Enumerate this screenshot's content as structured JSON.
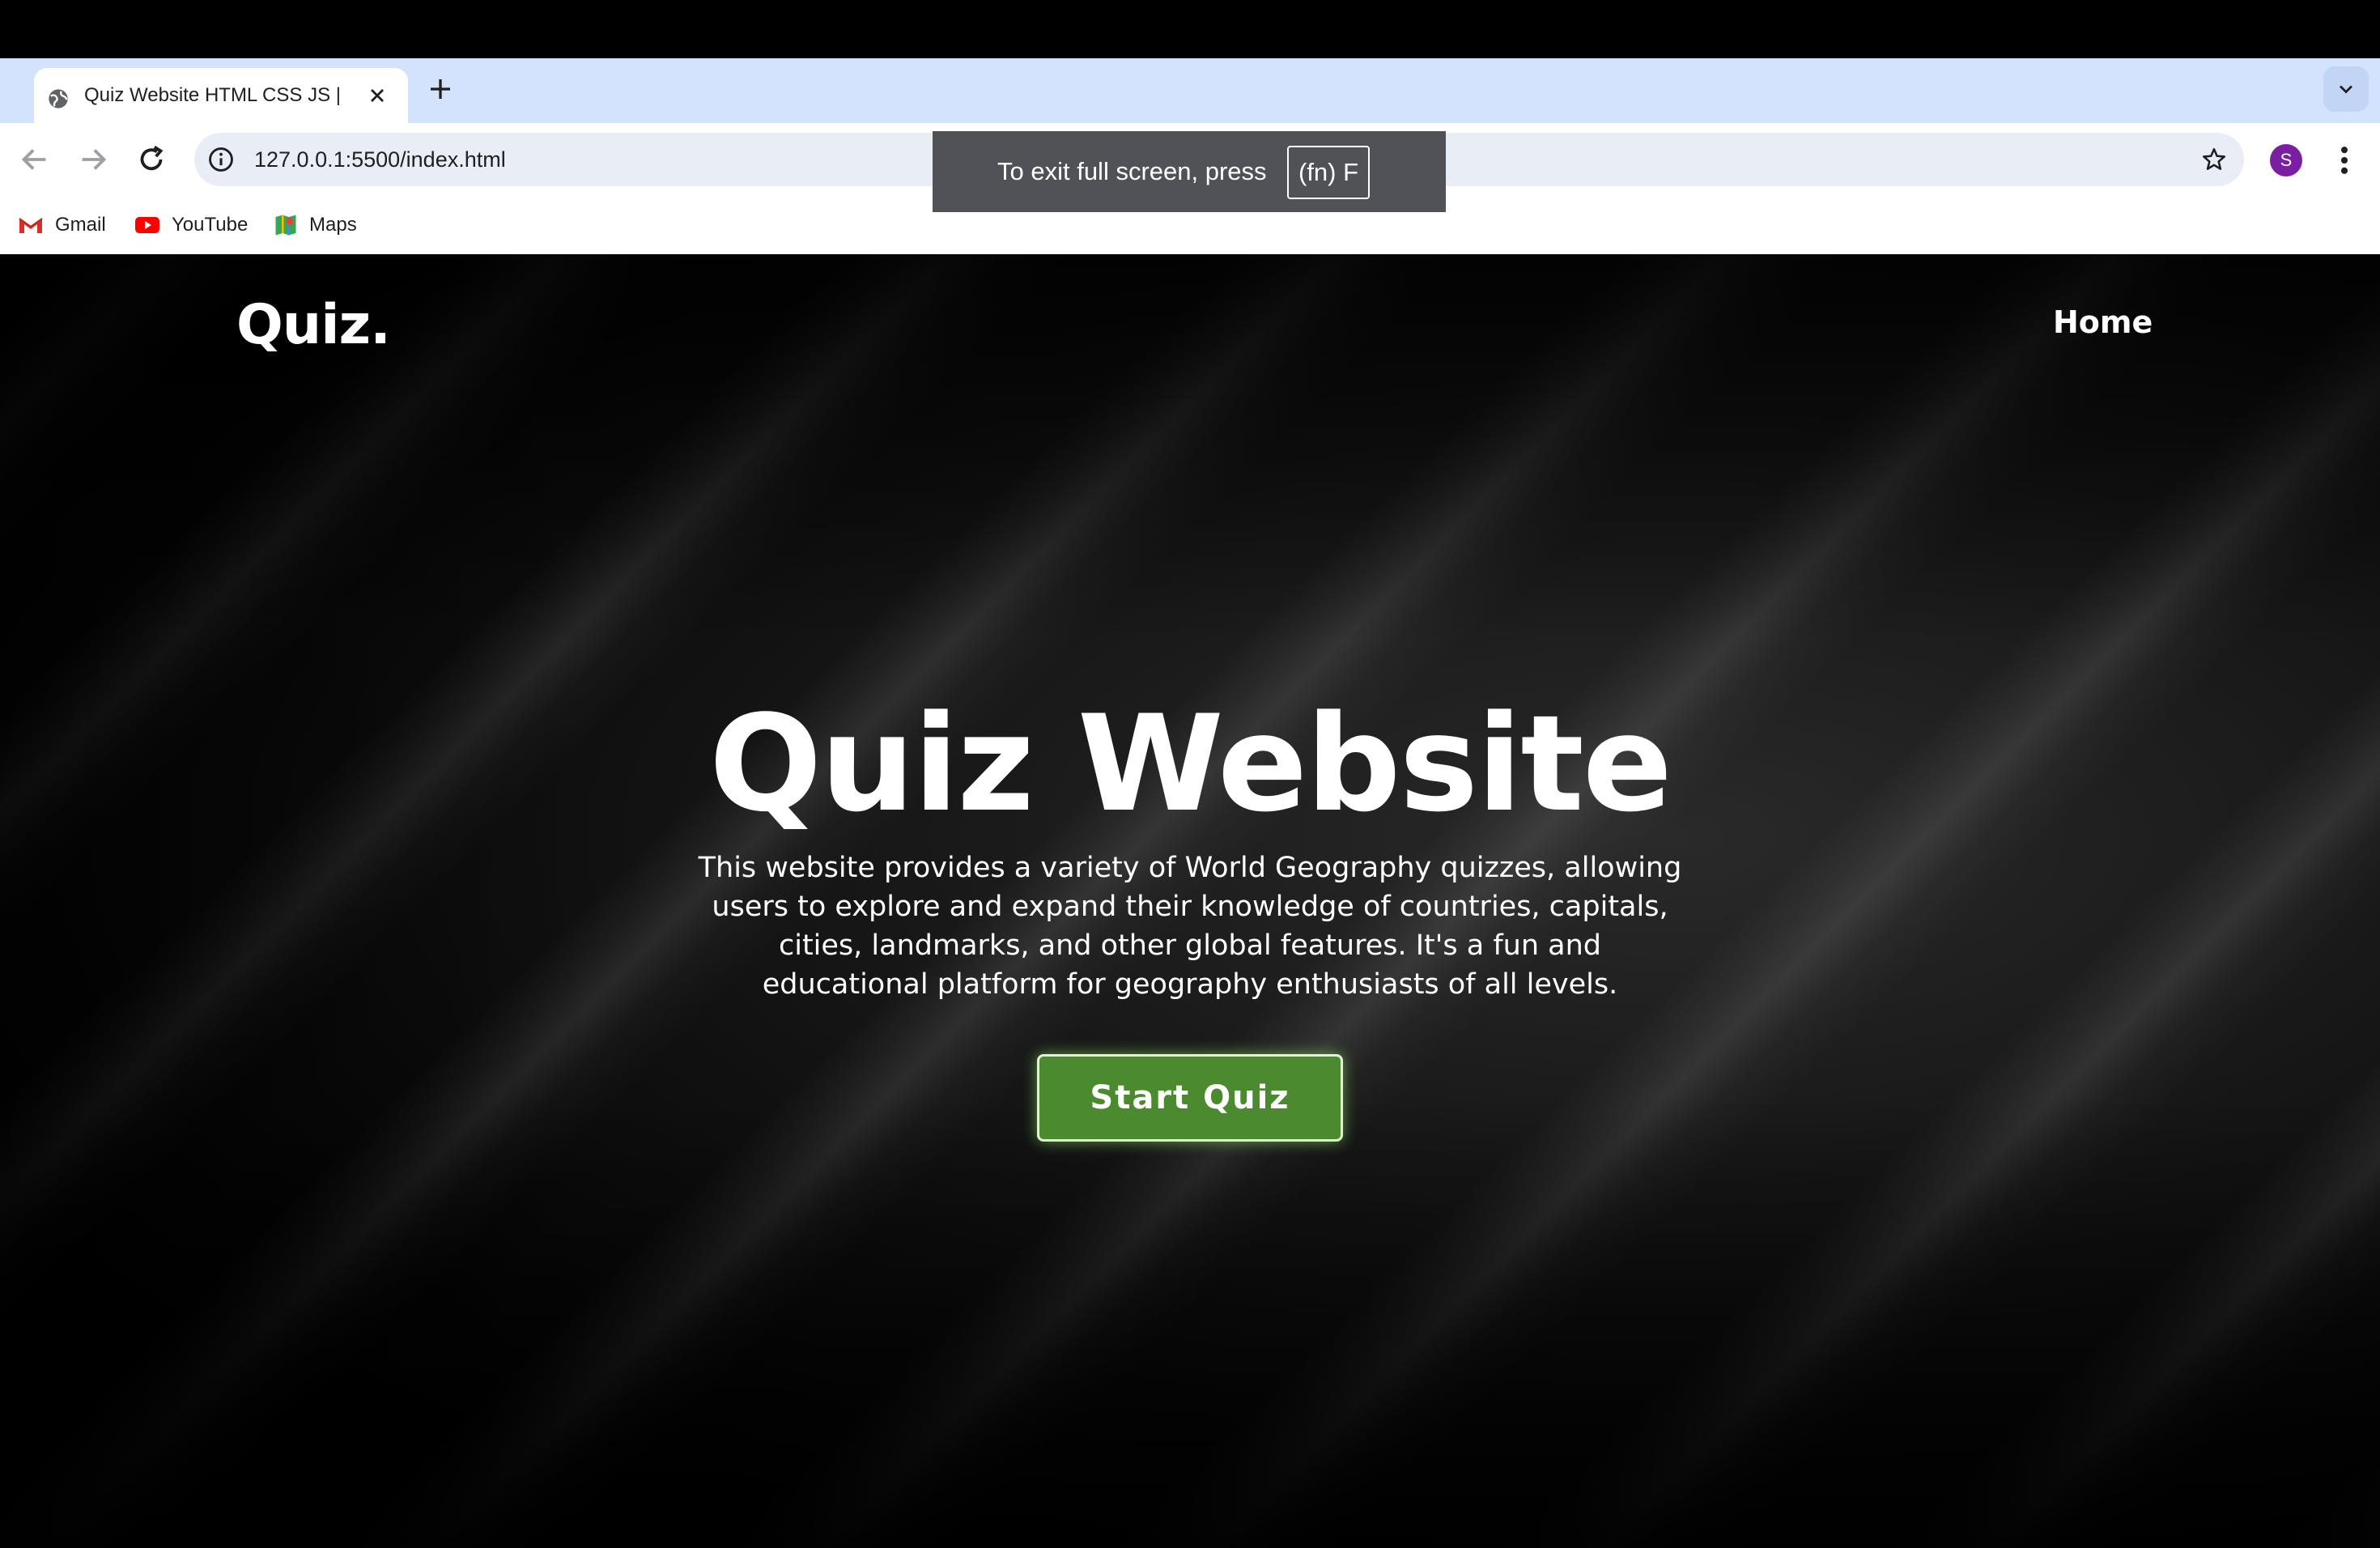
{
  "browser": {
    "tab": {
      "title": "Quiz Website HTML CSS JS |",
      "favicon": "globe-icon"
    },
    "url": "127.0.0.1:5500/index.html",
    "profile_initial": "S",
    "bookmarks": [
      {
        "label": "Gmail",
        "icon": "gmail-icon"
      },
      {
        "label": "YouTube",
        "icon": "youtube-icon"
      },
      {
        "label": "Maps",
        "icon": "maps-icon"
      }
    ],
    "fullscreen_notice": {
      "text": "To exit full screen, press",
      "key": "(fn) F"
    }
  },
  "page": {
    "logo": "Quiz.",
    "nav": {
      "home": "Home"
    },
    "hero": {
      "title": "Quiz Website",
      "description": "This website provides a variety of World Geography quizzes, allowing users to explore and expand their knowledge of countries, capitals, cities, landmarks, and other global features. It's a fun and educational platform for geography enthusiasts of all levels.",
      "button": "Start Quiz"
    }
  },
  "colors": {
    "tabstrip": "#d3e3fd",
    "button_green": "#4b8a2e",
    "avatar_purple": "#7b1fa2"
  }
}
